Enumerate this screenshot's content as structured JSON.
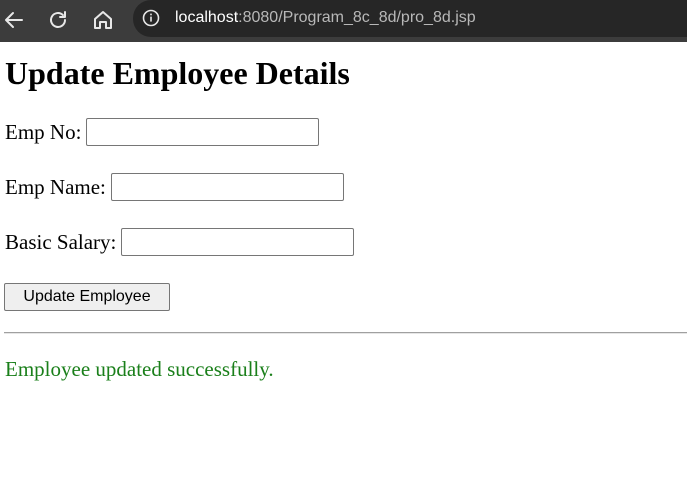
{
  "browser": {
    "url_host": "localhost",
    "url_path": ":8080/Program_8c_8d/pro_8d.jsp",
    "icons": {
      "back": "back-arrow-icon",
      "reload": "reload-icon",
      "home": "home-icon",
      "site_info": "info-icon"
    }
  },
  "page": {
    "title": "Update Employee Details",
    "form": {
      "emp_no_label": "Emp No:",
      "emp_no_value": "",
      "emp_name_label": "Emp Name:",
      "emp_name_value": "",
      "salary_label": "Basic Salary:",
      "salary_value": "",
      "submit_label": "Update Employee"
    },
    "message": {
      "text": "Employee updated successfully.",
      "color": "#1a7f1a"
    }
  },
  "colors": {
    "chrome_bg": "#3c3c3c",
    "omnibox_bg": "#262626"
  }
}
